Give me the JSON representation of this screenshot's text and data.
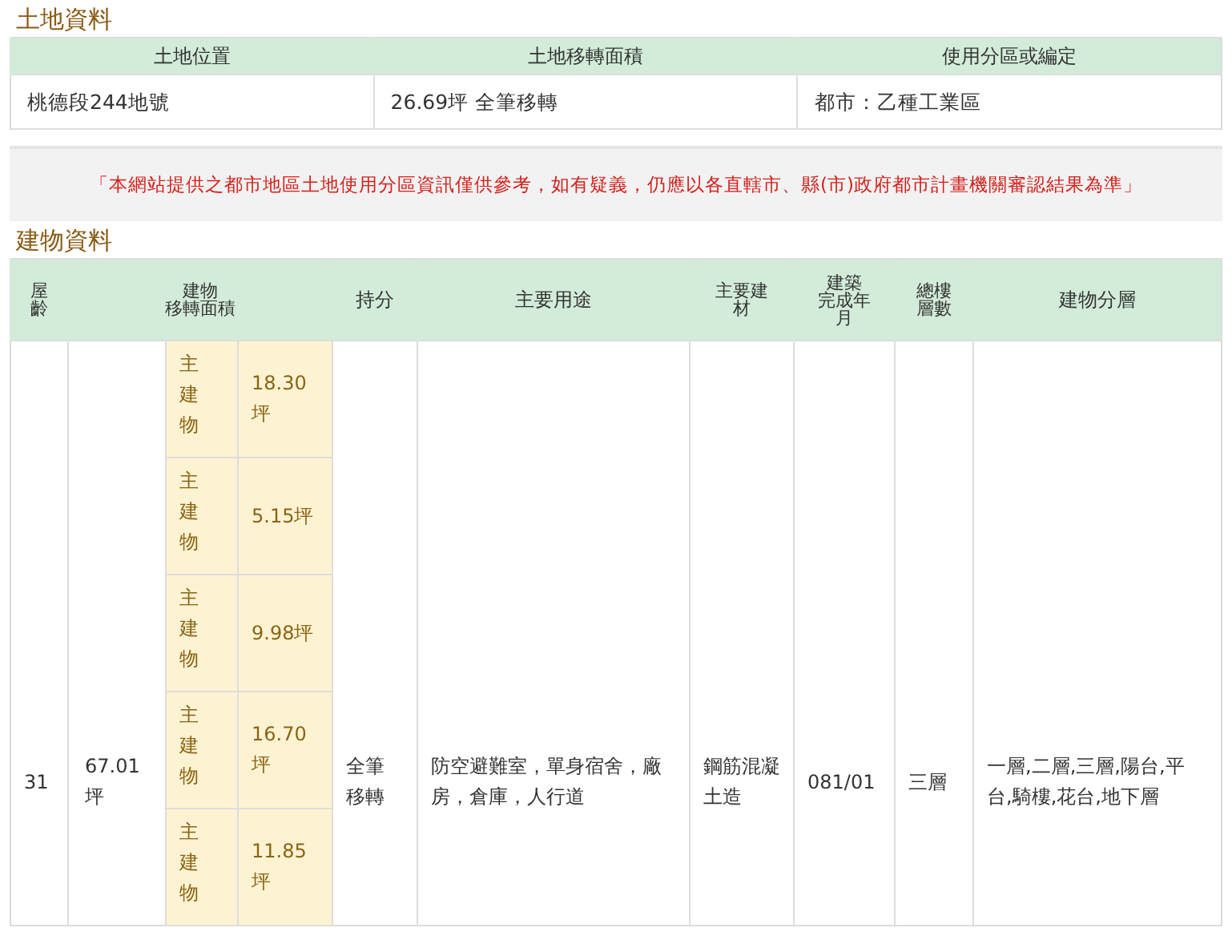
{
  "land": {
    "title": "土地資料",
    "columns": [
      "土地位置",
      "土地移轉面積",
      "使用分區或編定"
    ],
    "row": [
      "桃德段244地號",
      "26.69坪 全筆移轉",
      "都市：乙種工業區"
    ]
  },
  "notice": "「本網站提供之都市地區土地使用分區資訊僅供參考，如有疑義，仍應以各直轄市、縣(市)政府都市計畫機關審認結果為準」",
  "building": {
    "title": "建物資料",
    "columns": [
      [
        "屋",
        "齡"
      ],
      [
        "建物",
        "移轉面積"
      ],
      [
        "持分"
      ],
      [
        "主要用途"
      ],
      [
        "主要建",
        "材"
      ],
      [
        "建築",
        "完成年",
        "月"
      ],
      [
        "總樓",
        "層數"
      ],
      [
        "建物分層"
      ]
    ],
    "row": {
      "age": "31",
      "area": "67.01坪",
      "share": "全筆移轉",
      "use": "防空避難室，單身宿舍，廠房，倉庫，人行道",
      "material": "鋼筋混凝土造",
      "completed": "081/01",
      "floors": "三層",
      "levels": "一層,二層,三層,陽台,平台,騎樓,花台,地下層",
      "portions": [
        {
          "label": "主建物",
          "area": "18.30坪"
        },
        {
          "label": "主建物",
          "area": "5.15坪"
        },
        {
          "label": "主建物",
          "area": "9.98坪"
        },
        {
          "label": "主建物",
          "area": "16.70坪"
        },
        {
          "label": "主建物",
          "area": "11.85坪"
        }
      ]
    }
  }
}
